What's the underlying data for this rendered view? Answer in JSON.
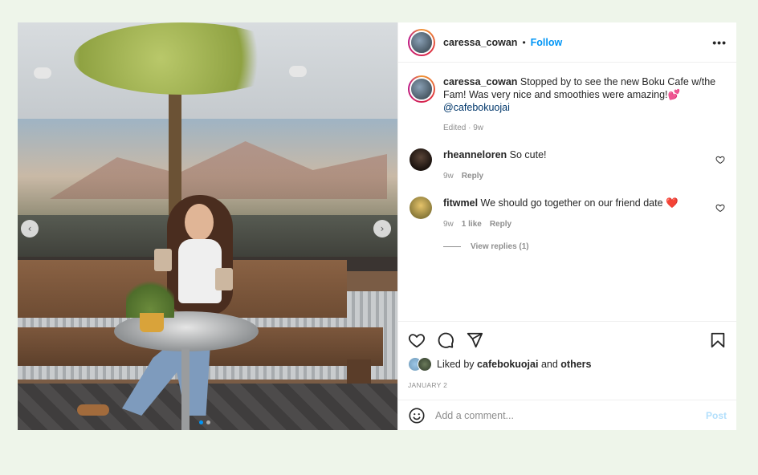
{
  "post": {
    "author": {
      "username": "caressa_cowan",
      "follow_label": "Follow",
      "separator": "•"
    },
    "more_label": "•••",
    "caption": {
      "username": "caressa_cowan",
      "text": "Stopped by to see the new Boku Cafe w/the Fam! Was very nice and smoothies were amazing!💕",
      "mention": "@cafebokuojai",
      "edited_label": "Edited",
      "meta_sep": " · ",
      "time": "9w"
    },
    "comments": [
      {
        "username": "rheanneloren",
        "text": "So cute!",
        "time": "9w",
        "likes": "",
        "reply_label": "Reply",
        "avatar_color": "#2b1d17"
      },
      {
        "username": "fitwmel",
        "text": "We should go together on our friend date ❤️",
        "time": "9w",
        "likes": "1 like",
        "reply_label": "Reply",
        "avatar_color": "#c9a34b"
      }
    ],
    "view_replies_label": "View replies (1)",
    "photo": {
      "prev_label": "‹",
      "next_label": "›",
      "slide_count": 2,
      "active_slide": 1
    },
    "likes": {
      "prefix": "Liked by",
      "user": "cafebokuojai",
      "middle": "and",
      "others": "others"
    },
    "date": "JANUARY 2",
    "add_comment": {
      "placeholder": "Add a comment...",
      "post_label": "Post"
    },
    "icons": [
      "heart-icon",
      "comment-icon",
      "share-icon",
      "bookmark-icon",
      "emoji-icon",
      "more-icon"
    ],
    "colors": {
      "follow": "#0095f6",
      "post_disabled": "#b2dffc",
      "muted": "#8e8e8e",
      "page_bg": "#eef5ea"
    }
  }
}
